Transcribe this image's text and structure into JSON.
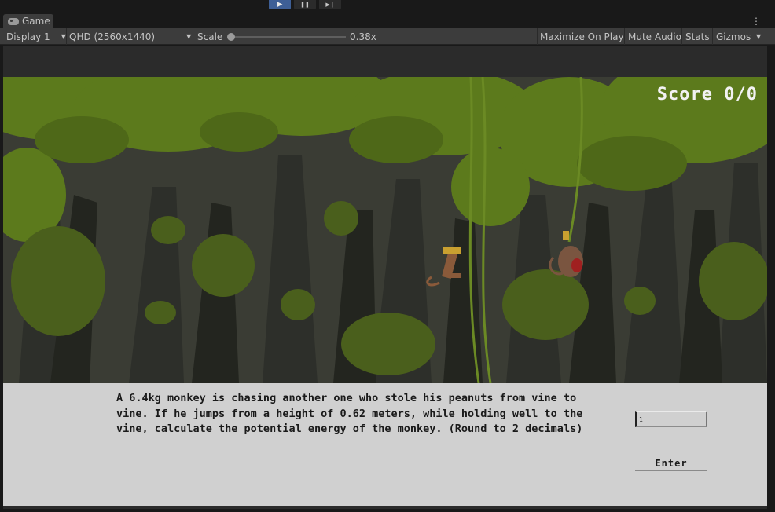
{
  "playbar": {
    "play_icon": "play-icon",
    "pause_icon": "pause-icon",
    "step_icon": "step-icon",
    "play_glyph": "▶",
    "pause_glyph": "❚❚",
    "step_glyph": "▶❙"
  },
  "tab": {
    "label": "Game",
    "icon": "gamepad-icon",
    "menu_glyph": "⋮"
  },
  "toolbar": {
    "display": "Display 1",
    "resolution": "QHD (2560x1440)",
    "scale_label": "Scale",
    "scale_value": "0.38x",
    "scale_fraction": 0.0,
    "maximize": "Maximize On Play",
    "mute": "Mute Audio",
    "stats": "Stats",
    "gizmos": "Gizmos",
    "dropdown_glyph": "▼"
  },
  "game": {
    "score": "Score 0/0",
    "question": "A 6.4kg monkey is chasing another one who stole his peanuts from vine to vine. If he jumps from a height of 0.62 meters, while holding well to the vine, calculate the potential energy of the monkey. (Round to 2 decimals)",
    "answer_value": "1",
    "enter_label": "Enter"
  },
  "colors": {
    "editor_bg": "#191919",
    "toolbar_bg": "#3c3c3c",
    "play_active": "#3e5f96",
    "canopy": "#5f7a1c",
    "panel": "#d0d0d0"
  }
}
